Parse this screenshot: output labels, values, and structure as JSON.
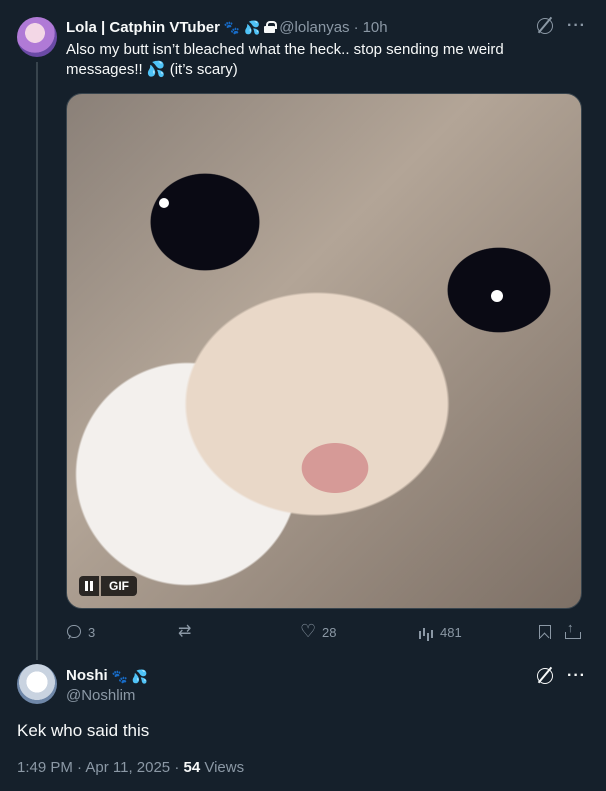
{
  "tweet1": {
    "author_name": "Lola | Catphin VTuber",
    "emoji_badges": [
      "🐾",
      "💦"
    ],
    "handle": "@lolanyas",
    "separator": "·",
    "time": "10h",
    "text": "Also my butt isn’t bleached what the heck.. stop sending me weird messages!! 💦 (it’s scary)",
    "media": {
      "type": "gif",
      "badge_label": "GIF",
      "alt": "crying cat"
    },
    "actions": {
      "replies": "3",
      "retweets": "",
      "likes": "28",
      "views": "481"
    }
  },
  "tweet2": {
    "author_name": "Noshi",
    "emoji_badges": [
      "🐾",
      "💦"
    ],
    "handle": "@Noshlim",
    "text": "Kek who said this",
    "timestamp": "1:49 PM · Apr 11, 2025 · ",
    "views_count": "54",
    "views_label": " Views"
  },
  "icons": {
    "grok": "grok-icon",
    "more": "more-icon",
    "lock": "lock-icon",
    "reply": "reply-icon",
    "retweet": "retweet-icon",
    "like": "like-icon",
    "views": "views-icon",
    "bookmark": "bookmark-icon",
    "share": "share-icon"
  },
  "colors": {
    "background": "#15202b",
    "text": "#f7f9f9",
    "secondary": "#8b98a5",
    "border": "#38444d"
  }
}
